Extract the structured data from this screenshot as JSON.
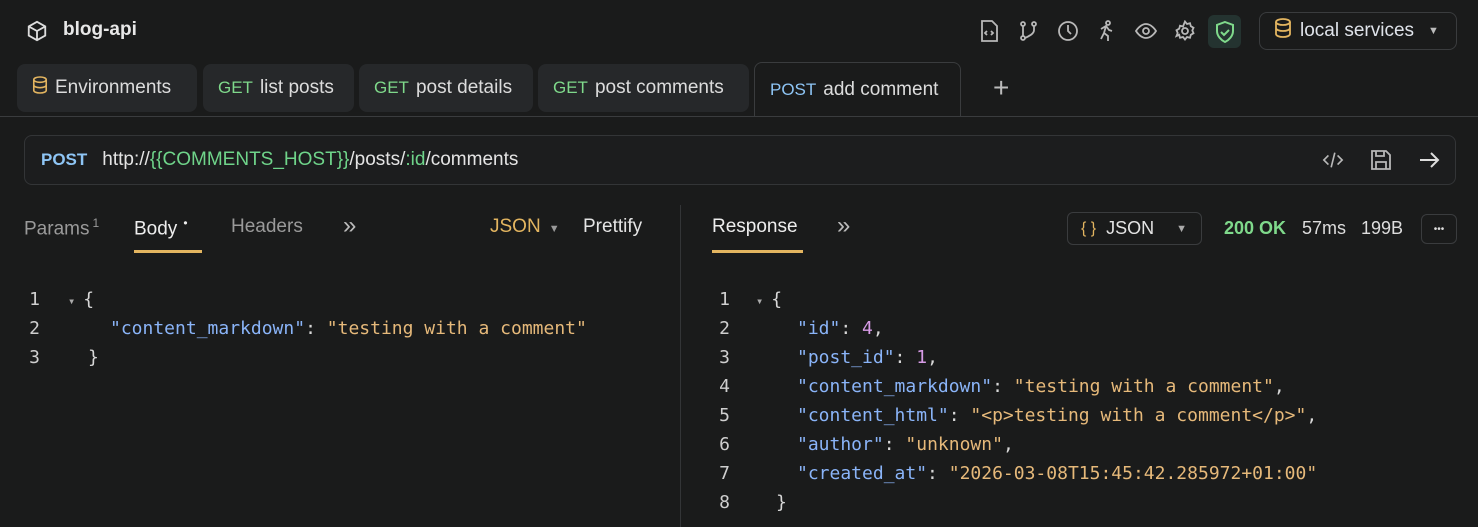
{
  "app": {
    "title": "blog-api",
    "environment": "local services"
  },
  "toolbar_icons": [
    "file-code-icon",
    "git-branch-icon",
    "history-icon",
    "runner-icon",
    "eye-icon",
    "gear-icon",
    "shield-check-icon"
  ],
  "tabs": [
    {
      "method": "",
      "label": "Environments"
    },
    {
      "method": "GET",
      "label": "list posts"
    },
    {
      "method": "GET",
      "label": "post details"
    },
    {
      "method": "GET",
      "label": "post comments"
    },
    {
      "method": "POST",
      "label": "add comment"
    }
  ],
  "request": {
    "method": "POST",
    "url_prefix": "http://",
    "url_var": "{{COMMENTS_HOST}}",
    "url_mid": "/posts/",
    "url_param": ":id",
    "url_suffix": "/comments"
  },
  "request_tabs": {
    "params": "Params",
    "params_count": "1",
    "body": "Body",
    "body_dot": "•",
    "headers": "Headers",
    "more": "»",
    "format": "JSON",
    "prettify": "Prettify"
  },
  "response_tabs": {
    "response": "Response",
    "more": "»",
    "format_icon": "{ }",
    "format": "JSON",
    "status": "200 OK",
    "time": "57ms",
    "size": "199B",
    "menu": "•••"
  },
  "body_lines": [
    {
      "n": "1",
      "k": "",
      "v": "{"
    },
    {
      "n": "2",
      "k": "\"content_markdown\"",
      "v": "\"testing with a comment\""
    },
    {
      "n": "3",
      "k": "",
      "v": "}"
    }
  ],
  "response_lines": [
    {
      "n": "1",
      "k": "",
      "v": "{",
      "t": "p",
      "c": ""
    },
    {
      "n": "2",
      "k": "\"id\"",
      "v": "4",
      "t": "n",
      "c": ","
    },
    {
      "n": "3",
      "k": "\"post_id\"",
      "v": "1",
      "t": "n",
      "c": ","
    },
    {
      "n": "4",
      "k": "\"content_markdown\"",
      "v": "\"testing with a comment\"",
      "t": "s",
      "c": ","
    },
    {
      "n": "5",
      "k": "\"content_html\"",
      "v": "\"<p>testing with a comment</p>\"",
      "t": "s",
      "c": ","
    },
    {
      "n": "6",
      "k": "\"author\"",
      "v": "\"unknown\"",
      "t": "s",
      "c": ","
    },
    {
      "n": "7",
      "k": "\"created_at\"",
      "v": "\"2026-03-08T15:45:42.285972+01:00\"",
      "t": "s",
      "c": ""
    },
    {
      "n": "8",
      "k": "",
      "v": "}",
      "t": "p",
      "c": ""
    }
  ]
}
